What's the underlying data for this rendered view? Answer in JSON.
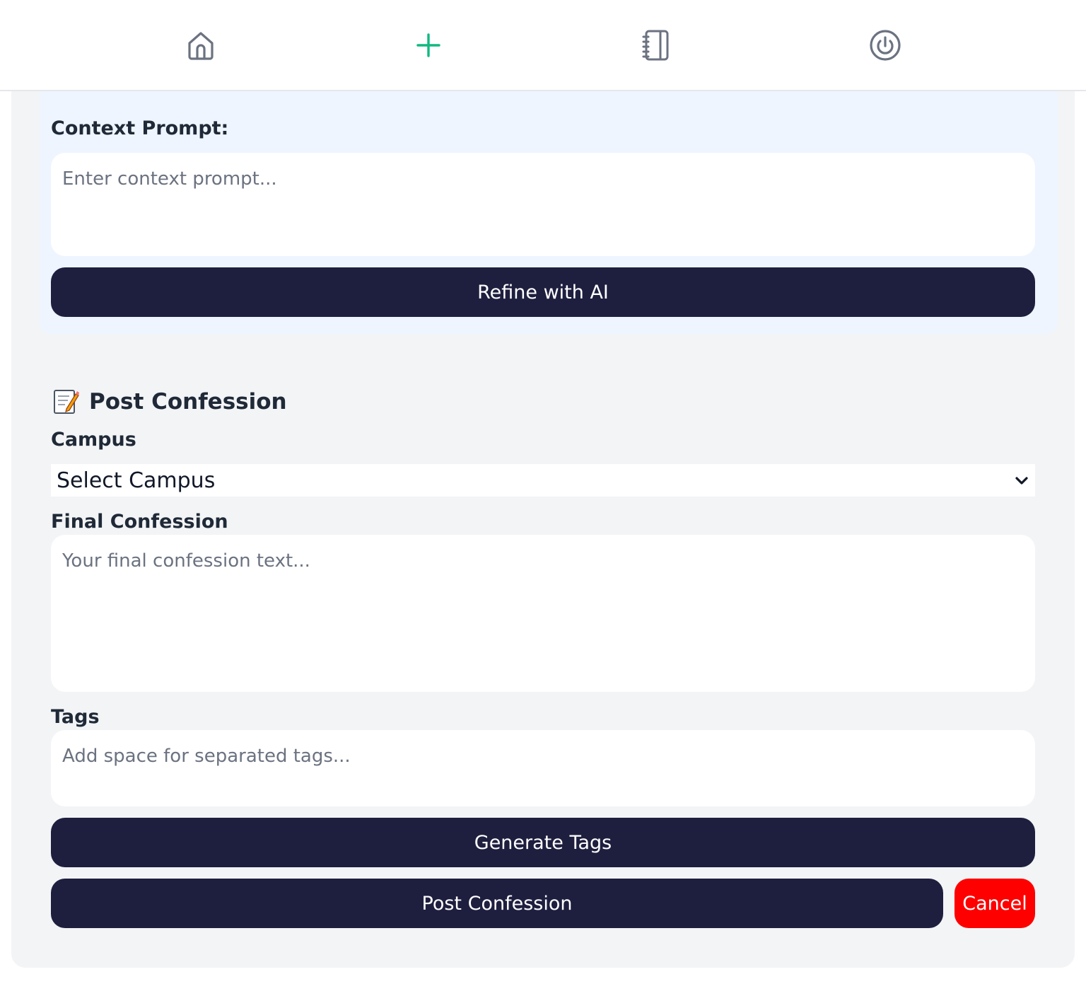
{
  "nav": {
    "items": [
      {
        "name": "home",
        "icon": "home-icon",
        "color": "#6b7280"
      },
      {
        "name": "create",
        "icon": "plus-icon",
        "color": "#10b981"
      },
      {
        "name": "notebook",
        "icon": "notebook-icon",
        "color": "#6b7280"
      },
      {
        "name": "logout",
        "icon": "power-icon",
        "color": "#6b7280"
      }
    ]
  },
  "ai": {
    "context_label": "Context Prompt:",
    "context_placeholder": "Enter context prompt...",
    "refine_button": "Refine with AI"
  },
  "post": {
    "title_icon": "memo-icon",
    "title": "Post Confession",
    "campus_label": "Campus",
    "campus_selected": "Select Campus",
    "final_label": "Final Confession",
    "final_placeholder": "Your final confession text...",
    "tags_label": "Tags",
    "tags_placeholder": "Add space for separated tags...",
    "generate_tags_button": "Generate Tags",
    "post_button": "Post Confession",
    "cancel_button": "Cancel"
  },
  "colors": {
    "button_dark": "#1e1e3f",
    "cancel": "#ff0000",
    "accent": "#10b981",
    "panel_blue": "#eef5fe",
    "card_bg": "#f3f4f6"
  }
}
